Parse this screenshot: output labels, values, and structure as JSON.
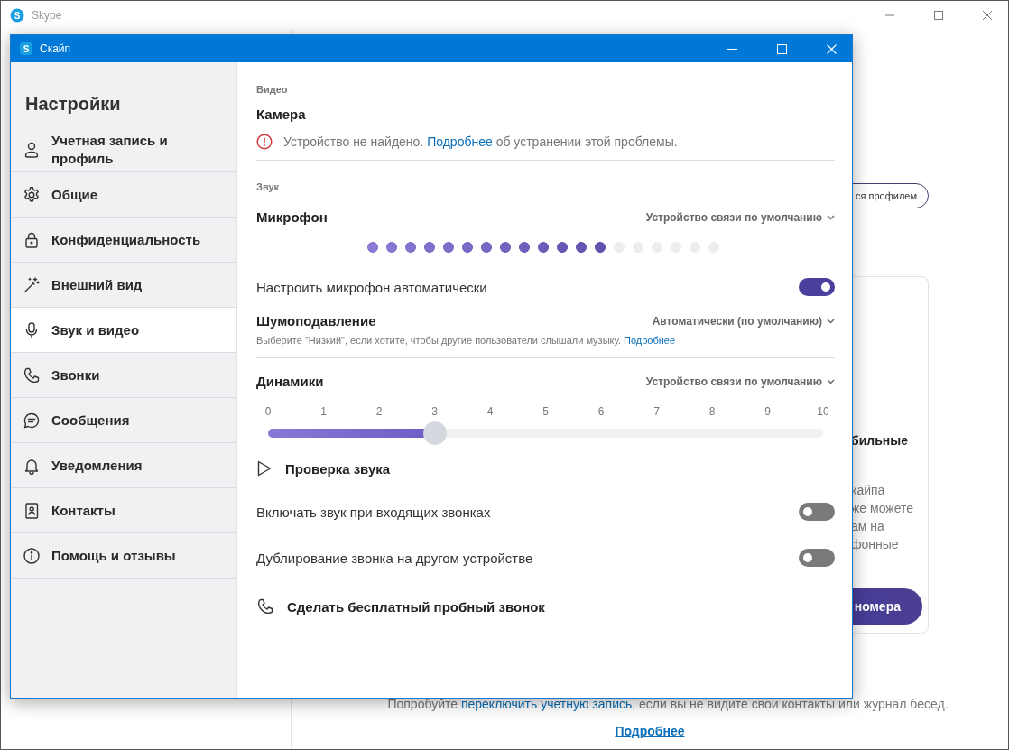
{
  "background_window": {
    "logo_letter": "S",
    "title": "Skype",
    "profile_button": "ся профилем",
    "card": {
      "title": "бильные",
      "text_lines": [
        "кайпа",
        "же можете",
        "ам на",
        "фонные"
      ],
      "button": "номера"
    },
    "footer": {
      "before": "Попробуйте ",
      "link": "переключить учетную запись",
      "after": ", если вы не видите свои контакты или журнал бесед.",
      "more_link": "Подробнее"
    }
  },
  "dialog": {
    "logo_letter": "S",
    "title": "Скайп",
    "sidebar": {
      "heading": "Настройки",
      "items": [
        {
          "label": "Учетная запись и профиль",
          "selected": false
        },
        {
          "label": "Общие",
          "selected": false
        },
        {
          "label": "Конфиденциальность",
          "selected": false
        },
        {
          "label": "Внешний вид",
          "selected": false
        },
        {
          "label": "Звук и видео",
          "selected": true
        },
        {
          "label": "Звонки",
          "selected": false
        },
        {
          "label": "Сообщения",
          "selected": false
        },
        {
          "label": "Уведомления",
          "selected": false
        },
        {
          "label": "Контакты",
          "selected": false
        },
        {
          "label": "Помощь и отзывы",
          "selected": false
        }
      ]
    },
    "video": {
      "heading": "Видео",
      "camera_label": "Камера",
      "error": {
        "before": "Устройство не найдено. ",
        "link": "Подробнее",
        "after": " об устранении этой проблемы."
      }
    },
    "sound": {
      "heading": "Звук",
      "microphone": {
        "label": "Микрофон",
        "device": "Устройство связи по умолчанию",
        "level": 0.68
      },
      "auto_mic": {
        "label": "Настроить микрофон автоматически",
        "on": true
      },
      "noise": {
        "label": "Шумоподавление",
        "value": "Автоматически (по умолчанию)",
        "hint": "Выберите \"Низкий\", если хотите, чтобы другие пользователи слышали музыку.",
        "hint_link": "Подробнее"
      },
      "speakers": {
        "label": "Динамики",
        "device": "Устройство связи по умолчанию",
        "scale": [
          "0",
          "1",
          "2",
          "3",
          "4",
          "5",
          "6",
          "7",
          "8",
          "9",
          "10"
        ],
        "level": 0.3
      },
      "test_sound": "Проверка звука",
      "toggles": [
        {
          "label": "Включать звук при входящих звонках",
          "on": false
        },
        {
          "label": "Дублирование звонка на другом устройстве",
          "on": false
        }
      ],
      "test_call": "Сделать бесплатный пробный звонок"
    }
  }
}
